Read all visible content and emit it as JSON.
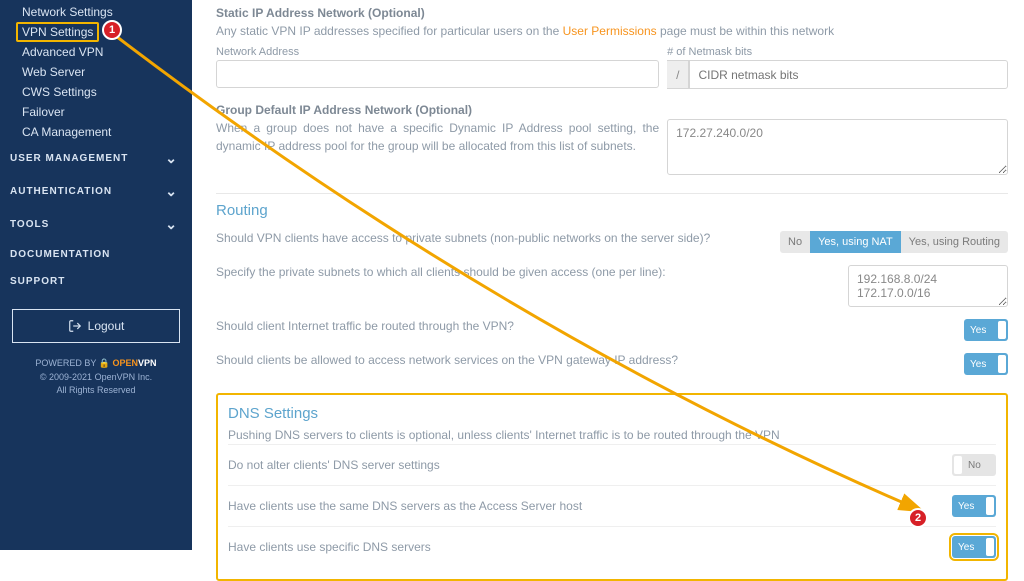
{
  "sidebar": {
    "config_items": [
      "Network Settings",
      "VPN Settings",
      "Advanced VPN",
      "Web Server",
      "CWS Settings",
      "Failover",
      "CA Management"
    ],
    "selected_index": 1,
    "sections": [
      "USER  MANAGEMENT",
      "AUTHENTICATION",
      "TOOLS",
      "DOCUMENTATION",
      "SUPPORT"
    ],
    "logout": "Logout",
    "powered": "POWERED BY",
    "brand1": "OPEN",
    "brand2": "VPN",
    "copy": "© 2009-2021 OpenVPN Inc.",
    "rights": "All Rights Reserved"
  },
  "static": {
    "heading": "Static IP Address Network (Optional)",
    "note_a": "Any static VPN IP addresses specified for particular users on the ",
    "note_link": "User Permissions",
    "note_b": " page must be within this network",
    "addr_label": "Network Address",
    "bits_label": "# of Netmask bits",
    "bits_placeholder": "CIDR netmask bits"
  },
  "group": {
    "heading": "Group Default IP Address Network (Optional)",
    "note": "When a group does not have a specific Dynamic IP Address pool setting, the dynamic IP address pool for the group will be allocated from this list of subnets.",
    "value": "172.27.240.0/20"
  },
  "routing": {
    "heading": "Routing",
    "q1": "Should VPN clients have access to private subnets (non-public networks on the server side)?",
    "opts": [
      "No",
      "Yes, using NAT",
      "Yes, using Routing"
    ],
    "q2": "Specify the private subnets to which all clients should be given access (one per line):",
    "subnets": "192.168.8.0/24\n172.17.0.0/16",
    "q3": "Should client Internet traffic be routed through the VPN?",
    "q4": "Should clients be allowed to access network services on the VPN gateway IP address?",
    "yes": "Yes"
  },
  "dns": {
    "heading": "DNS Settings",
    "sub": "Pushing DNS servers to clients is optional, unless clients' Internet traffic is to be routed through the VPN",
    "r1": "Do not alter clients' DNS server settings",
    "r2": "Have clients use the same DNS servers as the Access Server host",
    "r3": "Have clients use specific DNS servers",
    "no": "No",
    "yes": "Yes"
  },
  "annot": {
    "b1": "1",
    "b2": "2"
  }
}
